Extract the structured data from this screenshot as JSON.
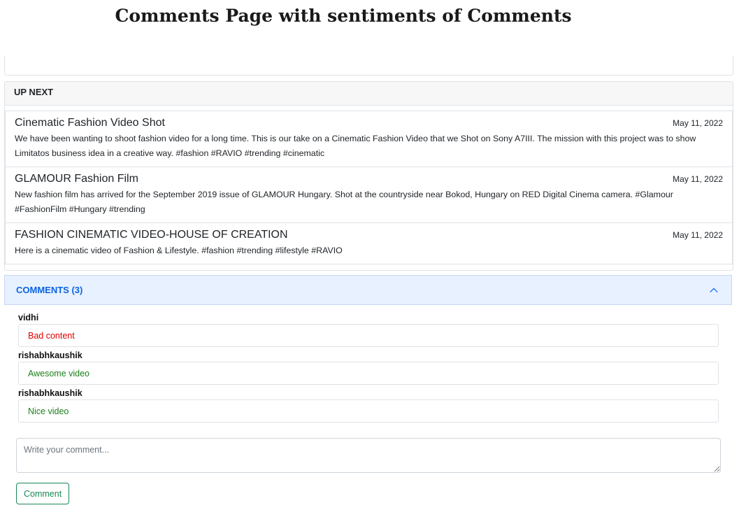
{
  "page": {
    "title": "Comments Page with sentiments of Comments"
  },
  "up_next": {
    "header": "UP NEXT",
    "videos": [
      {
        "title": "Cinematic Fashion Video Shot",
        "date": "May 11, 2022",
        "description": "We have been wanting to shoot fashion video for a long time. This is our take on a Cinematic Fashion Video that we Shot on Sony A7III. The mission with this project was to show Limitatos business idea in a creative way. #fashion #RAVIO #trending #cinematic"
      },
      {
        "title": "GLAMOUR Fashion Film",
        "date": "May 11, 2022",
        "description": "New fashion film has arrived for the September 2019 issue of GLAMOUR Hungary. Shot at the countryside near Bokod, Hungary on RED Digital Cinema camera. #Glamour #FashionFilm #Hungary #trending"
      },
      {
        "title": "FASHION CINEMATIC VIDEO-HOUSE OF CREATION",
        "date": "May 11, 2022",
        "description": "Here is a cinematic video of Fashion & Lifestyle. #fashion #trending #lifestyle #RAVIO"
      }
    ]
  },
  "comments": {
    "header": "COMMENTS (3)",
    "items": [
      {
        "user": "vidhi",
        "text": "Bad content",
        "sentiment": "negative"
      },
      {
        "user": "rishabhkaushik",
        "text": "Awesome video",
        "sentiment": "positive"
      },
      {
        "user": "rishabhkaushik",
        "text": "Nice video",
        "sentiment": "positive"
      }
    ],
    "input_placeholder": "Write your comment...",
    "button_label": "Comment"
  },
  "colors": {
    "negative": "#e00000",
    "positive": "#1a7f1a",
    "accent": "#0c63e4"
  },
  "icons": {
    "collapse": "chevron-up-icon"
  }
}
